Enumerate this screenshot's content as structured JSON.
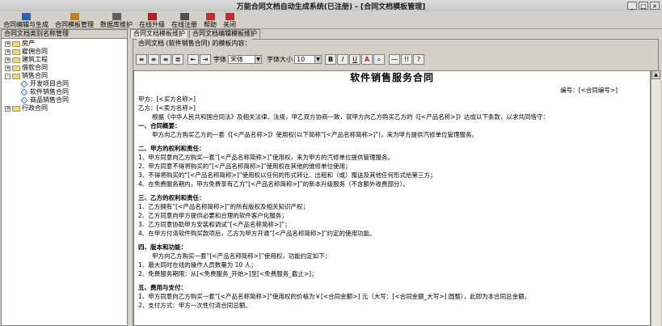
{
  "window": {
    "title": "万能合同文档自动生成系统(已注册) - [合同文档模板管理]"
  },
  "toolbar": {
    "items": [
      {
        "label": "合同编辑与生成",
        "color": "#3060b0"
      },
      {
        "label": "合同模板管理",
        "color": "#c08020"
      },
      {
        "label": "数据库维护",
        "color": "#606060"
      },
      {
        "label": "在线升级",
        "color": "#b02020"
      },
      {
        "label": "在线注册",
        "color": "#505050"
      },
      {
        "label": "帮助",
        "color": "#c03030"
      },
      {
        "label": "关闭",
        "color": "#c03030"
      }
    ]
  },
  "tree": {
    "header": "合同文档类别名称管理",
    "items": [
      {
        "label": "房产",
        "level": 0,
        "expander": "+"
      },
      {
        "label": "雇佣合同",
        "level": 0,
        "expander": "+"
      },
      {
        "label": "建筑工程",
        "level": 0,
        "expander": "+"
      },
      {
        "label": "借款合同",
        "level": 0,
        "expander": "+"
      },
      {
        "label": "销售合同",
        "level": 0,
        "expander": "-"
      },
      {
        "label": "开发项目合同",
        "level": 1
      },
      {
        "label": "软件销售合同",
        "level": 1
      },
      {
        "label": "商品销售合同",
        "level": 1
      },
      {
        "label": "行政合同",
        "level": 0,
        "expander": "+"
      }
    ]
  },
  "tabs": [
    "合同文档模板维护",
    "合同文档编辑模板维护"
  ],
  "group_label": "合同文档 (软件销售合同) 的模板内容：",
  "format": {
    "font_label": "字体",
    "font_value": "宋体",
    "size_label": "字体大小",
    "size_value": "10",
    "buttons": [
      "B",
      "I",
      "U",
      "A",
      "",
      "—",
      "!!",
      "?"
    ]
  },
  "document": {
    "title": "软件销售服务合同",
    "number": "编号：[<合同编号>]",
    "lines": [
      {
        "t": "甲方：[<买方名称>]",
        "s": ""
      },
      {
        "t": "乙方：[<卖方名称>]",
        "s": ""
      },
      {
        "t": "根据《中华人民共和国合同法》及相关法律、法规，甲乙双方协商一致，就甲方向乙方购买乙方的《[<产品名称>]》达成以下条款，以求共同恪守：",
        "s": "ind"
      },
      {
        "t": "一、合同概要：",
        "s": "bold"
      },
      {
        "t": "甲方向乙方购买乙方的一套《[<产品名称>]》使用权(以下简称“[<产品名称简称>]”)，来为甲方提供汽修单位管理服务。",
        "s": "ind"
      },
      {
        "t": "",
        "s": "gap"
      },
      {
        "t": "二、甲方的权利和责任：",
        "s": "bold"
      },
      {
        "t": "1、甲方同意向乙方购买一套“[<产品名称简称>]”使用权，来为甲方的汽修单位提供管理服务。",
        "s": ""
      },
      {
        "t": "2、甲方同意不得将购买的“[<产品名称简称>]”使用权在其他的维修单位使用；",
        "s": ""
      },
      {
        "t": "3、不得将购买的“[<产品名称简称>]”使用权以任何的形式转让、出租和（或）赠送及其他任何形式给第三方；",
        "s": ""
      },
      {
        "t": "4、在免费服务期内，甲方免费享有乙方“[<产品名称简称>]”的新本升级服务（不含额外收费部分）。",
        "s": ""
      },
      {
        "t": "",
        "s": "gap"
      },
      {
        "t": "三、乙方的权利和责任：",
        "s": "bold"
      },
      {
        "t": "1、乙方拥有“[<产品名称简称>]”的所有版权及相关知识产权；",
        "s": ""
      },
      {
        "t": "2、乙方同意向甲方提供必要和合理的软件客户化服务；",
        "s": ""
      },
      {
        "t": "3、乙方同意协助甲方安装和调试“[<产品名称简称>]”；",
        "s": ""
      },
      {
        "t": "4、在甲方付清软件购买款项后，乙方为甲方开通“[<产品名称简称>]”约定的使用功能。",
        "s": ""
      },
      {
        "t": "",
        "s": "gap"
      },
      {
        "t": "四、版本和功能：",
        "s": "bold"
      },
      {
        "t": "甲方向乙方购买一套“[<产品名称简称>]”使用权，功能约定如下：",
        "s": "ind"
      },
      {
        "t": "1、最大同时在线的操作人员数量为  10  人；",
        "s": ""
      },
      {
        "t": "2、免费服务期限：从[<免费服务_开始>]至[<免费服务_截止>]；",
        "s": ""
      },
      {
        "t": "",
        "s": "gap"
      },
      {
        "t": "五、费用与支付：",
        "s": "bold"
      },
      {
        "t": "1、甲方同意向乙方购买一套“[<产品名称简称>]”使用权的价格为￥[<合同金额>]  元（大写：[<合同金额_大写>] 圆整），此即为本合同总金额。",
        "s": ""
      },
      {
        "t": "2、支付方式：甲方一次性付清合同总额。",
        "s": ""
      }
    ]
  }
}
